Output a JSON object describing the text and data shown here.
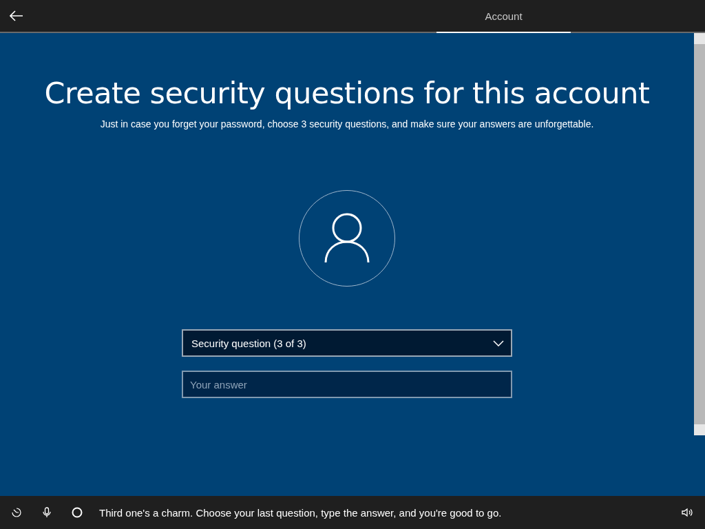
{
  "header": {
    "tabs": [
      {
        "label": "Account",
        "selected": true
      }
    ]
  },
  "page": {
    "title": "Create security questions for this account",
    "subtitle": "Just in case you forget your password, choose 3 security questions, and make sure your answers are unforgettable."
  },
  "question_dropdown": {
    "value": "Security question (3 of 3)"
  },
  "answer_field": {
    "placeholder": "Your answer"
  },
  "assistant_bar": {
    "caption": "Third one's a charm. Choose your last question, type the answer, and you're good to go."
  }
}
